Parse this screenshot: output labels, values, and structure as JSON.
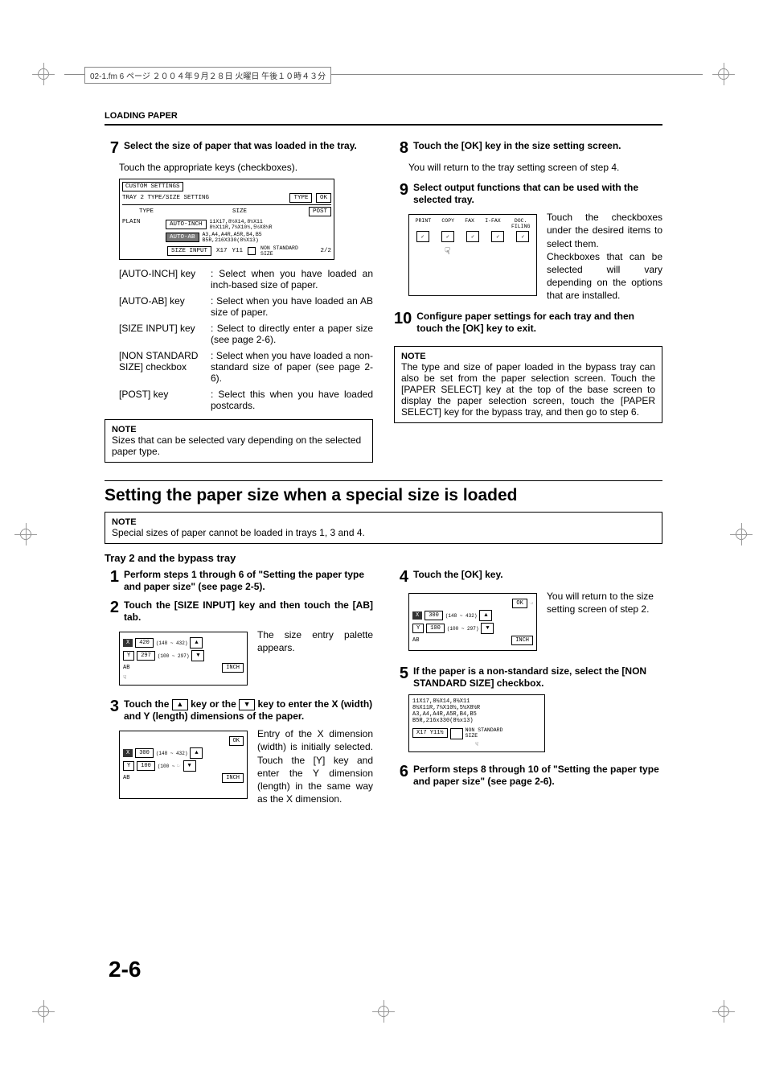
{
  "filepath": "02-1.fm 6 ページ ２００４年９月２８日 火曜日 午後１０時４３分",
  "header": "LOADING PAPER",
  "step7": {
    "title": "Select the size of paper that was loaded in the tray.",
    "sub": "Touch the appropriate keys (checkboxes).",
    "diagram": {
      "title": "CUSTOM SETTINGS",
      "subtitle": "TRAY 2 TYPE/SIZE SETTING",
      "typeBtn": "TYPE",
      "okBtn": "OK",
      "typeLabel": "TYPE",
      "sizeLabel": "SIZE",
      "postLabel": "POST",
      "plain": "PLAIN",
      "autoInch": "AUTO-INCH",
      "autoAb": "AUTO-AB",
      "sizes1": "11X17,8½X14,8½X11\n8½X11R,7¼X10½,5½X8½R",
      "sizes2": "A3,A4,A4R,A5R,B4,B5\nB5R,216X330(8½X13)",
      "sizeInput": "SIZE INPUT",
      "x17": "X17",
      "y11": "Y11",
      "nonStd": "NON STANDARD\nSIZE",
      "pager": "2/2"
    },
    "defs": [
      {
        "key": "[AUTO-INCH] key",
        "val": ": Select when you have loaded an inch-based size of paper."
      },
      {
        "key": "[AUTO-AB] key",
        "val": ": Select when you have loaded an AB size of paper."
      },
      {
        "key": "[SIZE INPUT] key",
        "val": ": Select to directly enter a paper size (see page 2-6)."
      },
      {
        "key": "[NON STANDARD SIZE] checkbox",
        "val": ": Select when you have loaded a non-standard size of paper (see page 2-6)."
      },
      {
        "key": "[POST] key",
        "val": ": Select this when you have loaded postcards."
      }
    ],
    "note": "Sizes that can be selected vary depending on the selected paper type."
  },
  "step8": {
    "title": "Touch the [OK] key in the size setting screen.",
    "sub": "You will return to the tray setting screen of step 4."
  },
  "step9": {
    "title": "Select output functions that can be used with the selected tray.",
    "funcs": [
      "PRINT",
      "COPY",
      "FAX",
      "I-FAX",
      "DOC.\nFILING"
    ],
    "body": "Touch the checkboxes under the desired items to select them.\nCheckboxes that can be selected will vary depending on the options that are installed."
  },
  "step10": {
    "title": "Configure paper settings for each tray and then touch the [OK] key to exit."
  },
  "noteRight": "The type and size of paper loaded in the bypass tray can also be set from the paper selection screen. Touch the [PAPER SELECT] key at the top of the base screen to display the paper selection screen, touch the [PAPER SELECT] key for the bypass tray, and then go to step 6.",
  "sectionTitle": "Setting the paper size when a special size is loaded",
  "sectionNote": "Special sizes of paper cannot be loaded in trays 1, 3 and 4.",
  "tray2Title": "Tray 2 and the bypass tray",
  "b_step1": "Perform steps 1 through 6 of \"Setting the paper type and paper size\" (see page 2-5).",
  "b_step2": {
    "title": "Touch the [SIZE INPUT] key and then touch the [AB] tab.",
    "screen": {
      "x": "420",
      "y": "297",
      "xr": "(148 ~ 432)",
      "yr": "(100 ~ 297)",
      "ab": "AB",
      "inch": "INCH"
    },
    "body": "The size entry palette appears."
  },
  "b_step3": {
    "titleA": "Touch the ",
    "titleB": " key or the ",
    "titleC": " key to enter the X (width) and Y (length) dimensions of the paper.",
    "screen": {
      "ok": "OK",
      "x": "300",
      "y": "100",
      "xr": "(148 ~ 432)",
      "yr": "(100 ~",
      "ab": "AB",
      "inch": "INCH"
    },
    "body": "Entry of the X dimension (width) is initially selected. Touch the [Y] key and enter the Y dimension (length) in the same way as the X dimension."
  },
  "b_step4": {
    "title": "Touch the [OK] key.",
    "screen": {
      "ok": "OK",
      "x": "300",
      "y": "100",
      "xr": "(148 ~ 432)",
      "yr": "(100 ~ 297)",
      "ab": "AB",
      "inch": "INCH"
    },
    "body": "You will return to the size setting screen of step 2."
  },
  "b_step5": {
    "title": "If the paper is a non-standard size, select the [NON STANDARD SIZE] checkbox.",
    "screen": {
      "l1": "11X17,8½X14,8½X11",
      "l2": "8½X11R,7¼X10½,5½X8½R",
      "l3": "A3,A4,A4R,A5R,B4,B5",
      "l4": "B5R,216x330(8½x13)",
      "btn1": "X17  Y11½",
      "btn2": "NON STANDARD\nSIZE"
    }
  },
  "b_step6": "Perform steps 8 through 10 of \"Setting the paper type and paper size\" (see page 2-6).",
  "noteLabel": "NOTE",
  "pageNum": "2-6"
}
